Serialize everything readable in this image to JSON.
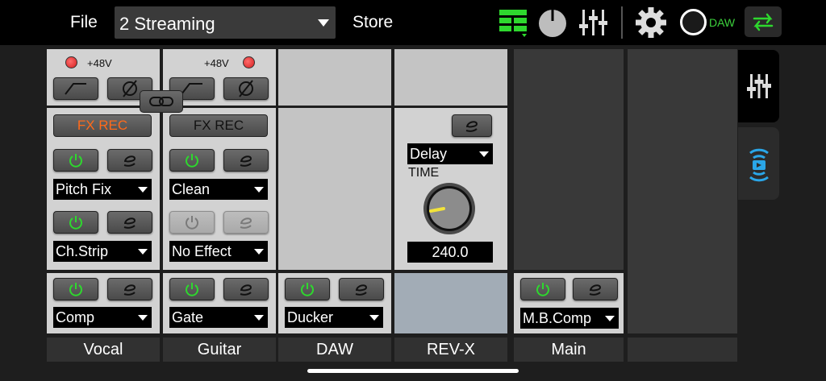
{
  "topbar": {
    "file_label": "File",
    "scene_value": "2  Streaming",
    "store_label": "Store",
    "daw_label": "DAW"
  },
  "link_button": "link-icon",
  "colors": {
    "fx_rec_active": "#ff6a1a",
    "power_on": "#2ed82e",
    "daw_green": "#3cd13c",
    "accent_blue": "#2aa6e8",
    "knob_indicator": "#f2e33a"
  },
  "channels": {
    "vocal": {
      "phantom": "+48V",
      "fx_rec": "FX REC",
      "slot1": "Pitch Fix",
      "slot2": "Ch.Strip",
      "dyn": "Comp",
      "name": "Vocal"
    },
    "guitar": {
      "phantom": "+48V",
      "fx_rec": "FX REC",
      "slot1": "Clean",
      "slot2": "No Effect",
      "dyn": "Gate",
      "name": "Guitar"
    },
    "daw": {
      "dyn": "Ducker",
      "name": "DAW"
    },
    "revx": {
      "effect": "Delay",
      "param_label": "TIME",
      "param_value": "240.0",
      "name": "REV-X"
    },
    "main": {
      "dyn": "M.B.Comp",
      "name": "Main"
    }
  }
}
